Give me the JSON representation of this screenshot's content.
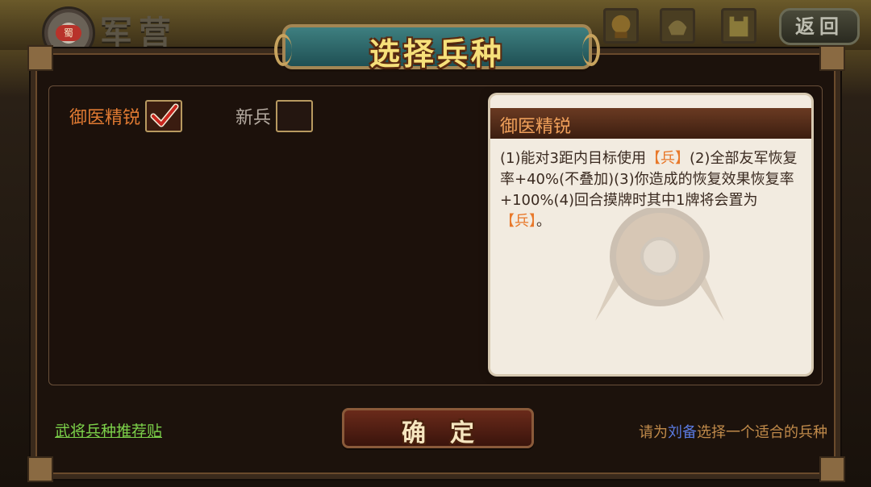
{
  "topbar": {
    "logo_text": "蜀",
    "title": "军营",
    "icons": [
      "warrior-portrait-icon",
      "helmet-portrait-icon",
      "fortress-icon"
    ],
    "back_label": "返回"
  },
  "dialog": {
    "title": "选择兵种",
    "options": [
      {
        "label": "御医精锐",
        "checked": true
      },
      {
        "label": "新兵",
        "checked": false
      }
    ],
    "info": {
      "title": "御医精锐",
      "desc_part1": "(1)能对3距内目标使用",
      "desc_hl1": "【兵】",
      "desc_part2": "(2)全部友军恢复率+40%(不叠加)(3)你造成的恢复效果恢复率+100%(4)回合摸牌时其中1牌将会置为",
      "desc_hl2": "【兵】",
      "desc_end": "。"
    },
    "recommend_link": "武将兵种推荐贴",
    "confirm_label": "确定",
    "hint_prefix": "请为",
    "hint_name": "刘备",
    "hint_suffix": "选择一个适合的兵种"
  },
  "colors": {
    "accent_orange": "#e07a32",
    "link_green": "#7cd24a",
    "name_blue": "#5a7ae0"
  }
}
